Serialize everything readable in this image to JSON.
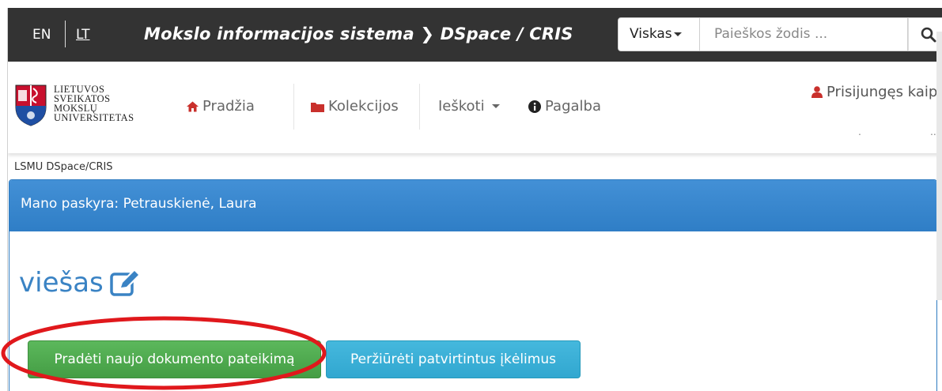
{
  "topbar": {
    "lang_en": "EN",
    "lang_lt": "LT",
    "site_title": "Mokslo informacijos sistema ❯ DSpace / CRIS",
    "search_scope": "Viskas",
    "search_placeholder": "Paieškos žodis ..."
  },
  "navbar": {
    "logo_lines": [
      "LIETUVOS",
      "SVEIKATOS",
      "MOKSLŲ",
      "UNIVERSITETAS"
    ],
    "home": "Pradžia",
    "collections": "Kolekcijos",
    "search": "Ieškoti",
    "help": "Pagalba",
    "logged_in": "Prisijungęs kaip"
  },
  "breadcrumb": "LSMU DSpace/CRIS",
  "panel": {
    "heading": "Mano paskyra: Petrauskienė, Laura",
    "title": "viešas",
    "start_submission": "Pradėti naujo dokumento pateikimą",
    "view_accepted": "Peržiūrėti patvirtintus įkėlimus"
  },
  "colors": {
    "topbar_bg": "#333333",
    "panel_heading": "#3581c9",
    "green_button": "#5cb85c",
    "cyan_button": "#3ab0d8",
    "highlight_ring": "#e0181c"
  }
}
